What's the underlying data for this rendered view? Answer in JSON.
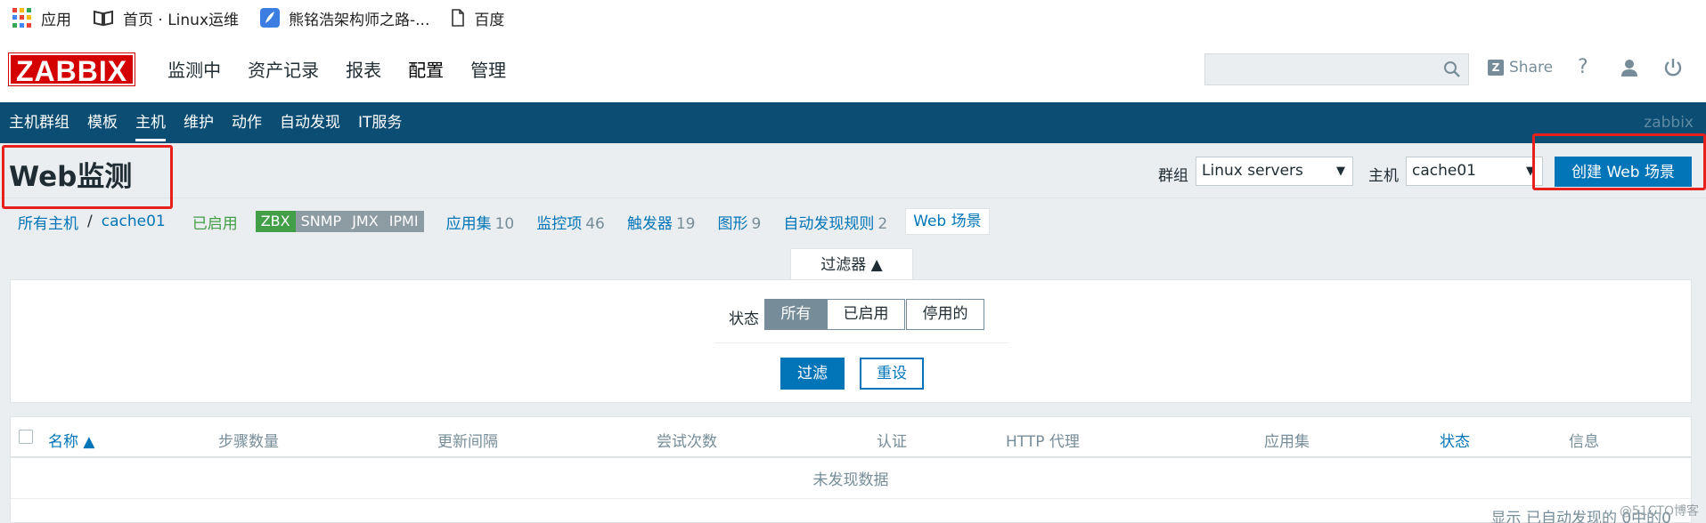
{
  "bookmarks": [
    {
      "label": "应用",
      "icon": "apps-grid-icon"
    },
    {
      "label": "首页 · Linux运维",
      "icon": "book-icon"
    },
    {
      "label": "熊铭浩架构师之路-...",
      "icon": "feather-icon"
    },
    {
      "label": "百度",
      "icon": "page-icon"
    }
  ],
  "header": {
    "logo": "ZABBIX",
    "menu": [
      "监测中",
      "资产记录",
      "报表",
      "配置",
      "管理"
    ],
    "active_menu": "配置",
    "share_label": "Share",
    "share_badge": "Z",
    "help": "?"
  },
  "subnav": {
    "items": [
      "主机群组",
      "模板",
      "主机",
      "维护",
      "动作",
      "自动发现",
      "IT服务"
    ],
    "active": "主机",
    "user": "zabbix"
  },
  "title_row": {
    "title": "Web监测",
    "group_label": "群组",
    "group_value": "Linux servers",
    "host_label": "主机",
    "host_value": "cache01",
    "create_button": "创建 Web 场景"
  },
  "hostnav": {
    "all_hosts": "所有主机",
    "separator": "/",
    "host": "cache01",
    "status": "已启用",
    "badges": [
      "ZBX",
      "SNMP",
      "JMX",
      "IPMI"
    ],
    "links": [
      {
        "label": "应用集",
        "count": "10"
      },
      {
        "label": "监控项",
        "count": "46"
      },
      {
        "label": "触发器",
        "count": "19"
      },
      {
        "label": "图形",
        "count": "9"
      },
      {
        "label": "自动发现规则",
        "count": "2"
      }
    ],
    "web_tab": "Web 场景"
  },
  "filter": {
    "tab_label": "过滤器 ▲",
    "status_label": "状态",
    "options": [
      "所有",
      "已启用",
      "停用的"
    ],
    "selected": "所有",
    "apply": "过滤",
    "reset": "重设"
  },
  "table": {
    "columns": [
      "名称 ▲",
      "步骤数量",
      "更新间隔",
      "尝试次数",
      "认证",
      "HTTP 代理",
      "应用集",
      "状态",
      "信息"
    ],
    "empty_text": "未发现数据",
    "footer": "显示 已自动发现的 0中的0"
  },
  "watermark": "@51CTO博客",
  "colors": {
    "brand_red": "#d40000",
    "nav_blue": "#0b4d73",
    "link_blue": "#0275b8",
    "enabled_green": "#429e47",
    "highlight_red": "#e8201c"
  }
}
